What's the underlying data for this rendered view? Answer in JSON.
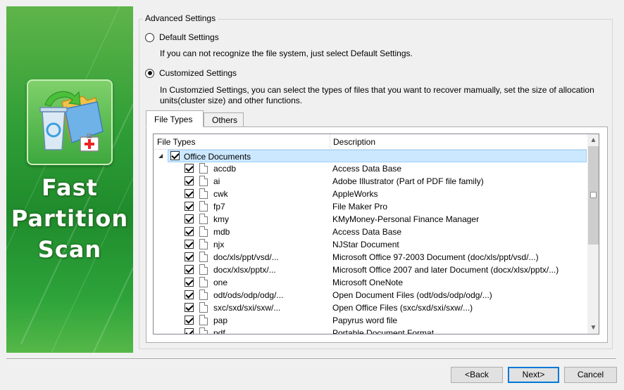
{
  "banner": {
    "product_lines": [
      "Fast",
      "Partition",
      "Scan"
    ],
    "logo_icon": "recycle-bin-folder-icon"
  },
  "advanced": {
    "legend": "Advanced Settings",
    "default_label": "Default Settings",
    "default_desc": "If you can not recognize the file system, just select Default Settings.",
    "custom_label": "Customized Settings",
    "custom_desc_line1": "In Customzied Settings, you can select the types of files that you want to recover mamually, set the size of allocation",
    "custom_desc_line2": "units(cluster size)  and other functions.",
    "selected": "custom"
  },
  "tabs": [
    {
      "label": "File Types",
      "active": true
    },
    {
      "label": "Others",
      "active": false
    }
  ],
  "grid": {
    "col_type": "File Types",
    "col_desc": "Description",
    "group_label": "Office Documents",
    "rows": [
      {
        "ext": "accdb",
        "desc": "Access Data Base"
      },
      {
        "ext": "ai",
        "desc": "Adobe Illustrator (Part of PDF file family)"
      },
      {
        "ext": "cwk",
        "desc": "AppleWorks"
      },
      {
        "ext": "fp7",
        "desc": "File Maker Pro"
      },
      {
        "ext": "kmy",
        "desc": "KMyMoney-Personal Finance Manager"
      },
      {
        "ext": "mdb",
        "desc": "Access Data Base"
      },
      {
        "ext": "njx",
        "desc": "NJStar Document"
      },
      {
        "ext": "doc/xls/ppt/vsd/...",
        "desc": "Microsoft Office 97-2003 Document (doc/xls/ppt/vsd/...)"
      },
      {
        "ext": "docx/xlsx/pptx/...",
        "desc": "Microsoft Office 2007 and later Document (docx/xlsx/pptx/...)"
      },
      {
        "ext": "one",
        "desc": "Microsoft OneNote"
      },
      {
        "ext": "odt/ods/odp/odg/...",
        "desc": "Open Document Files (odt/ods/odp/odg/...)"
      },
      {
        "ext": "sxc/sxd/sxi/sxw/...",
        "desc": "Open Office Files (sxc/sxd/sxi/sxw/...)"
      },
      {
        "ext": "pap",
        "desc": "Papyrus word file"
      },
      {
        "ext": "pdf",
        "desc": "Portable Document Format"
      }
    ]
  },
  "buttons": {
    "back": "<Back",
    "next": "Next>",
    "cancel": "Cancel"
  },
  "colors": {
    "banner_green": "#2f9e36",
    "selection_blue": "#cce8ff",
    "default_button_border": "#0078d7"
  }
}
